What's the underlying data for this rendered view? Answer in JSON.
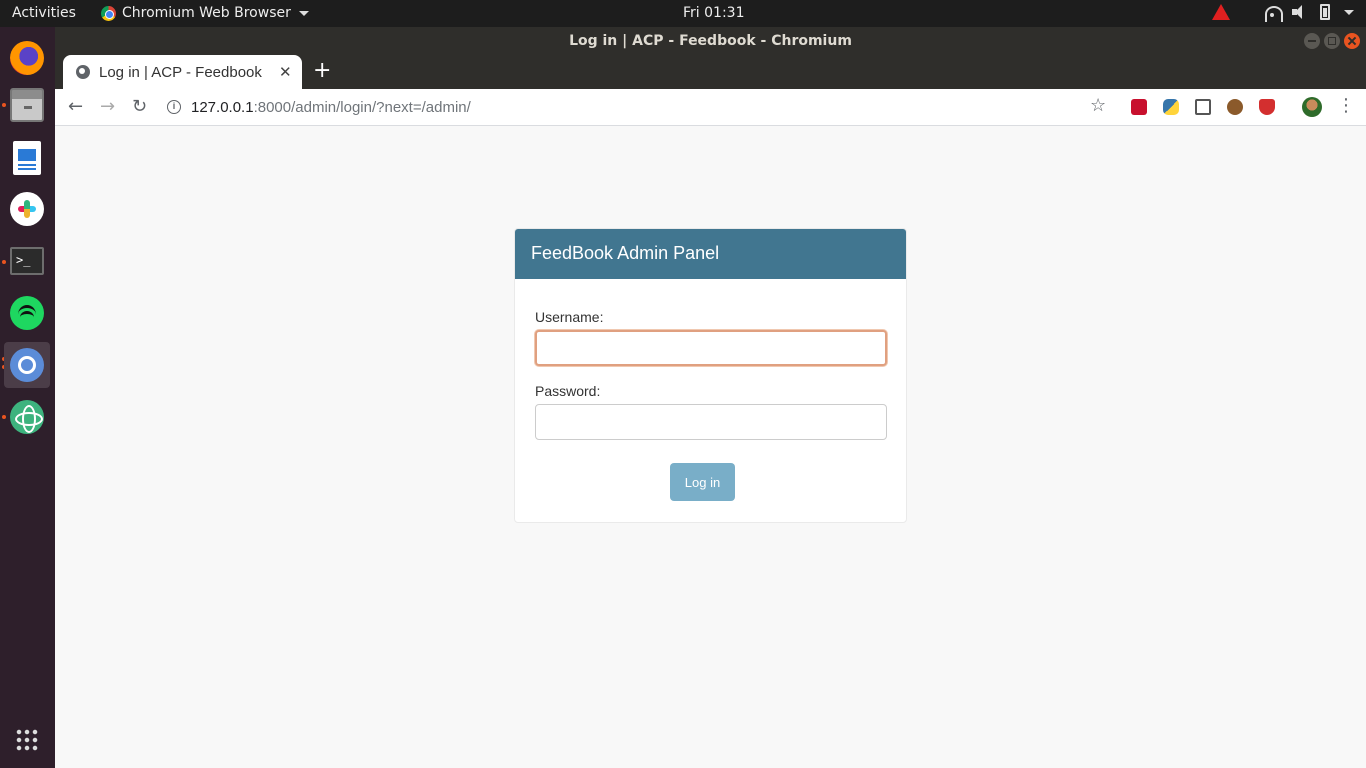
{
  "topbar": {
    "activities": "Activities",
    "app_name": "Chromium Web Browser",
    "clock": "Fri 01:31"
  },
  "dock": {
    "items": [
      {
        "name": "firefox-icon"
      },
      {
        "name": "files-icon"
      },
      {
        "name": "libreoffice-writer-icon"
      },
      {
        "name": "slack-icon"
      },
      {
        "name": "terminal-icon",
        "glyph": ">_"
      },
      {
        "name": "spotify-icon"
      },
      {
        "name": "chromium-icon"
      },
      {
        "name": "atom-icon"
      },
      {
        "name": "show-applications-icon"
      }
    ]
  },
  "window": {
    "title": "Log in | ACP - Feedbook - Chromium"
  },
  "browser": {
    "tab_title": "Log in | ACP - Feedbook",
    "tab_close": "✕",
    "new_tab": "+",
    "back": "←",
    "forward": "→",
    "reload": "↻",
    "url_host": "127.0.0.1",
    "url_path": ":8000/admin/login/?next=/admin/",
    "bookmark": "☆",
    "menu": "⋮"
  },
  "login": {
    "header": "FeedBook Admin Panel",
    "username_label": "Username:",
    "username_value": "",
    "password_label": "Password:",
    "password_value": "",
    "submit_label": "Log in",
    "header_color": "#417690",
    "button_color": "#79aec8"
  }
}
